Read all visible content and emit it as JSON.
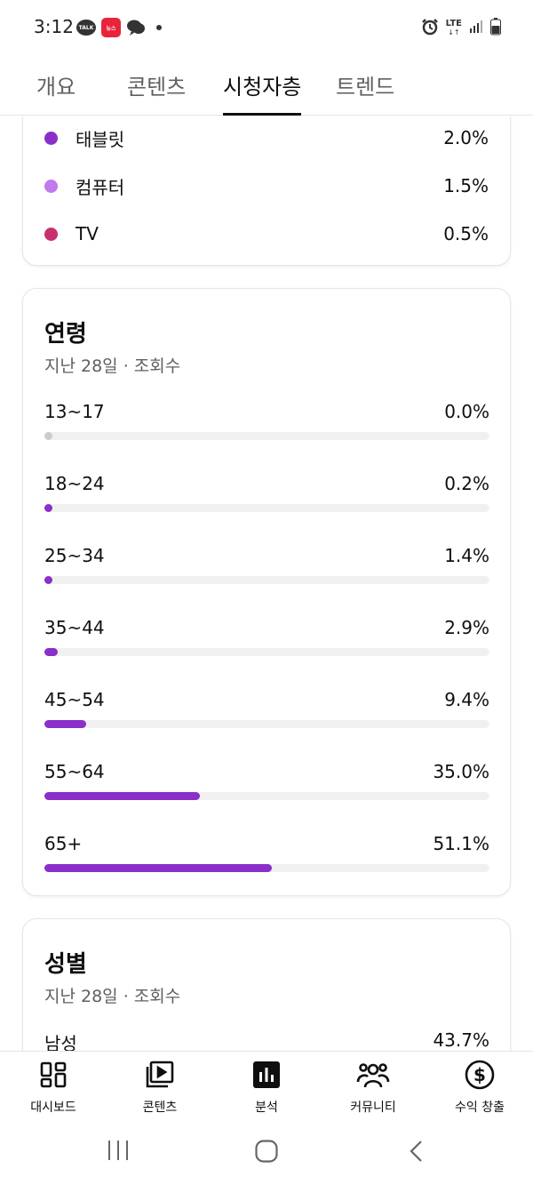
{
  "status_bar": {
    "time": "3:12",
    "talk_icon_text": "TALK",
    "news_icon_text": "뉴스",
    "network": "LTE"
  },
  "tabs": [
    {
      "label": "개요",
      "active": false
    },
    {
      "label": "콘텐츠",
      "active": false
    },
    {
      "label": "시청자층",
      "active": true
    },
    {
      "label": "트렌드",
      "active": false
    }
  ],
  "device_card": {
    "rows": [
      {
        "label": "태블릿",
        "value": "2.0%",
        "color": "#8b2fc9"
      },
      {
        "label": "컴퓨터",
        "value": "1.5%",
        "color": "#c27aef"
      },
      {
        "label": "TV",
        "value": "0.5%",
        "color": "#c9306f"
      }
    ]
  },
  "age_card": {
    "title": "연령",
    "subtitle": "지난 28일 · 조회수",
    "rows": [
      {
        "label": "13~17",
        "value": "0.0%",
        "fraction": 0.0
      },
      {
        "label": "18~24",
        "value": "0.2%",
        "fraction": 0.002
      },
      {
        "label": "25~34",
        "value": "1.4%",
        "fraction": 0.014
      },
      {
        "label": "35~44",
        "value": "2.9%",
        "fraction": 0.029
      },
      {
        "label": "45~54",
        "value": "9.4%",
        "fraction": 0.094
      },
      {
        "label": "55~64",
        "value": "35.0%",
        "fraction": 0.35
      },
      {
        "label": "65+",
        "value": "51.1%",
        "fraction": 0.511
      }
    ]
  },
  "gender_card": {
    "title": "성별",
    "subtitle": "지난 28일 · 조회수",
    "rows": [
      {
        "label": "남성",
        "value": "43.7%"
      }
    ]
  },
  "bottom_nav": [
    {
      "label": "대시보드",
      "icon": "dashboard-icon"
    },
    {
      "label": "콘텐츠",
      "icon": "content-icon"
    },
    {
      "label": "분석",
      "icon": "analytics-icon",
      "active": true
    },
    {
      "label": "커뮤니티",
      "icon": "community-icon"
    },
    {
      "label": "수익 창출",
      "icon": "monetization-icon"
    }
  ],
  "colors": {
    "accent": "#8b2fc9",
    "zero_bar": "#cccccc",
    "track": "#f0f0f0"
  }
}
